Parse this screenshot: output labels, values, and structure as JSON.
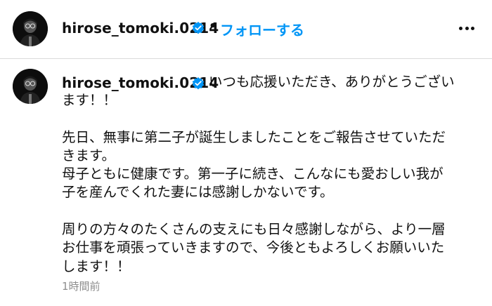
{
  "header": {
    "username": "hirose_tomoki.0214",
    "separator": "•",
    "follow_label": "フォローする",
    "icons": {
      "verified": "verified-badge-icon",
      "more": "more-options-icon",
      "avatar": "profile-avatar"
    }
  },
  "caption": {
    "username": "hirose_tomoki.0214",
    "first_line": "いつも応援いただき、ありがとうござい",
    "body": "ます！！\n\n先日、無事に第二子が誕生しましたことをご報告させていただ\nきます。\n母子ともに健康です。第一子に続き、こんなにも愛おしい我が\n子を産んでくれた妻には感謝しかないです。\n\n周りの方々のたくさんの支えにも日々感謝しながら、より一層\nお仕事を頑張っていきますので、今後ともよろしくお願いいた\nします！！",
    "timestamp": "1時間前"
  },
  "colors": {
    "accent": "#0095f6",
    "text": "#111111",
    "muted": "#8e8e8e",
    "divider": "#dbdbdb"
  }
}
